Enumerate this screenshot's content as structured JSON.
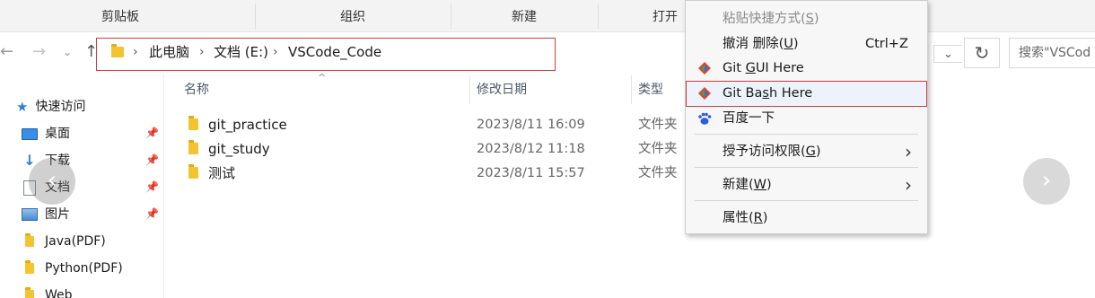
{
  "ribbon": {
    "groups": [
      "剪贴板",
      "组织",
      "新建",
      "打开"
    ]
  },
  "address": {
    "crumbs": [
      "此电脑",
      "文档 (E:)",
      "VSCode_Code"
    ],
    "search_placeholder": "搜索\"VSCode_Code\"",
    "search_visible": "搜索\"VSCod"
  },
  "sidebar": {
    "quick_access": "快速访问",
    "items": [
      {
        "label": "桌面",
        "icon": "desktop-icon",
        "pinned": true
      },
      {
        "label": "下载",
        "icon": "download-arrow-icon",
        "pinned": true
      },
      {
        "label": "文档",
        "icon": "document-icon",
        "pinned": true
      },
      {
        "label": "图片",
        "icon": "picture-icon",
        "pinned": true
      },
      {
        "label": "Java(PDF)",
        "icon": "folder-icon",
        "pinned": false
      },
      {
        "label": "Python(PDF)",
        "icon": "folder-icon",
        "pinned": false
      },
      {
        "label": "Web",
        "icon": "folder-icon",
        "pinned": false
      }
    ]
  },
  "columns": {
    "name": "名称",
    "modified": "修改日期",
    "type": "类型"
  },
  "files": [
    {
      "name": "git_practice",
      "modified": "2023/8/11 16:09",
      "type": "文件夹"
    },
    {
      "name": "git_study",
      "modified": "2023/8/12 11:18",
      "type": "文件夹"
    },
    {
      "name": "测试",
      "modified": "2023/8/11 15:57",
      "type": "文件夹"
    }
  ],
  "context_menu": {
    "paste_shortcut": {
      "label": "粘贴快捷方式(",
      "key": "S",
      "tail": ")"
    },
    "undo_delete": {
      "label": "撤消 删除(",
      "key": "U",
      "tail": ")",
      "shortcut": "Ctrl+Z"
    },
    "git_gui": {
      "pre": "Git ",
      "key": "G",
      "post": "UI Here"
    },
    "git_bash": {
      "pre": "Git Ba",
      "key": "s",
      "post": "h Here"
    },
    "baidu": {
      "label": "百度一下"
    },
    "grant_access": {
      "label": "授予访问权限(",
      "key": "G",
      "tail": ")"
    },
    "new": {
      "label": "新建(",
      "key": "W",
      "tail": ")"
    },
    "properties": {
      "label": "属性(",
      "key": "R",
      "tail": ")"
    }
  },
  "colors": {
    "highlight_outline": "#d23b3b",
    "folder_yellow": "#f4c430",
    "quick_access_star": "#2d7de0"
  }
}
